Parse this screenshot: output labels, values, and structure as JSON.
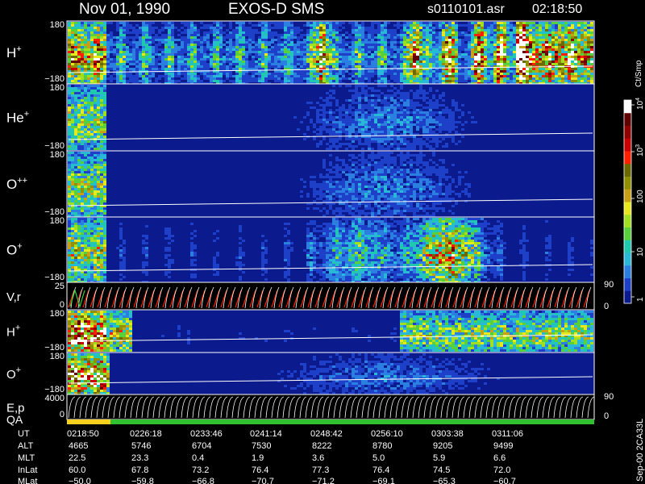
{
  "header": {
    "date": "Nov 01, 1990",
    "instrument": "EXOS-D SMS",
    "filename": "s0110101.asr",
    "time": "02:18:50"
  },
  "panels": [
    {
      "label": "H",
      "charge": "+",
      "y_top": "180",
      "y_bottom": "−180"
    },
    {
      "label": "He",
      "charge": "+",
      "y_top": "180",
      "y_bottom": "−180"
    },
    {
      "label": "O",
      "charge": "++",
      "y_top": "180",
      "y_bottom": "−180"
    },
    {
      "label": "O",
      "charge": "+",
      "y_top": "180",
      "y_bottom": "−180"
    },
    {
      "label": "V,r",
      "charge": "",
      "y_top": "25",
      "y_bottom": "0",
      "right_top": "90",
      "right_bottom": "0"
    },
    {
      "label": "H",
      "charge": "+",
      "y_top": "180",
      "y_bottom": "−180"
    },
    {
      "label": "O",
      "charge": "+",
      "y_top": "180",
      "y_bottom": "−180"
    },
    {
      "label": "E,p",
      "charge": "",
      "y_top": "4000",
      "y_bottom": "0",
      "right_top": "90",
      "right_bottom": "0"
    }
  ],
  "qa_label": "QA",
  "colorbar": {
    "unit": "Ct/Smp",
    "ticks": [
      {
        "label": "1"
      },
      {
        "label": "10"
      },
      {
        "label": "100"
      },
      {
        "label": "10",
        "sup": "3"
      },
      {
        "label": "10",
        "sup": "4"
      }
    ],
    "colors": [
      "#0b1a8c",
      "#1e3fc8",
      "#2a7fe0",
      "#2ab8d8",
      "#20c8b0",
      "#58d03c",
      "#a0e020",
      "#e8e820",
      "#c8a018",
      "#909000",
      "#6a6a00",
      "#ff2000",
      "#c80000",
      "#900000",
      "#600000",
      "#ffffff"
    ]
  },
  "side_note": "Sep-00  2CA33L",
  "table": {
    "row_labels": [
      "UT",
      "ALT",
      "MLT",
      "InLat",
      "MLat"
    ],
    "columns": [
      [
        "0218:50",
        "4665",
        "22.5",
        "60.0",
        "−50.0"
      ],
      [
        "0226:18",
        "5746",
        "23.3",
        "67.8",
        "−59.8"
      ],
      [
        "0233:46",
        "6704",
        "0.4",
        "73.2",
        "−66.8"
      ],
      [
        "0241:14",
        "7530",
        "1.9",
        "76.4",
        "−70.7"
      ],
      [
        "0248:42",
        "8222",
        "3.6",
        "77.3",
        "−71.2"
      ],
      [
        "0256:10",
        "8780",
        "5.0",
        "76.4",
        "−69.1"
      ],
      [
        "0303:38",
        "9205",
        "5.9",
        "74.5",
        "−65.3"
      ],
      [
        "0311:06",
        "9499",
        "6.6",
        "72.0",
        "−60.7"
      ]
    ]
  },
  "chart_data": {
    "type": "heatmap",
    "title": "Nov 01, 1990   EXOS-D SMS",
    "x_ticks": [
      "0218:50",
      "0226:18",
      "0233:46",
      "0241:14",
      "0248:42",
      "0256:10",
      "0303:38",
      "0311:06"
    ],
    "panel_ylim": [
      [
        -180,
        180
      ],
      [
        -180,
        180
      ],
      [
        -180,
        180
      ],
      [
        -180,
        180
      ],
      [
        0,
        25
      ],
      [
        -180,
        180
      ],
      [
        -180,
        180
      ],
      [
        0,
        4000
      ]
    ],
    "colorbar_range": [
      1,
      10000
    ],
    "colorbar_scale": "log"
  }
}
